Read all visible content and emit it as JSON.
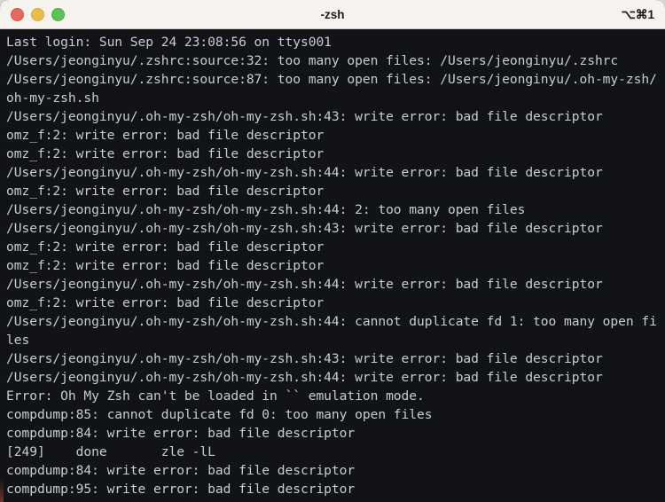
{
  "window": {
    "title": "-zsh",
    "shortcut": "⌥⌘1",
    "controls": {
      "close_label": "close",
      "minimize_label": "minimize",
      "zoom_label": "zoom"
    },
    "colors": {
      "titlebar_bg": "#f6f2ee",
      "terminal_bg": "#121317",
      "terminal_fg": "#c8ccd4",
      "close": "#e4695e",
      "minimize": "#e8bd4c",
      "zoom": "#5cc257"
    }
  },
  "terminal": {
    "output": "Last login: Sun Sep 24 23:08:56 on ttys001\n/Users/jeonginyu/.zshrc:source:32: too many open files: /Users/jeonginyu/.zshrc\n/Users/jeonginyu/.zshrc:source:87: too many open files: /Users/jeonginyu/.oh-my-zsh/oh-my-zsh.sh\n/Users/jeonginyu/.oh-my-zsh/oh-my-zsh.sh:43: write error: bad file descriptor\nomz_f:2: write error: bad file descriptor\nomz_f:2: write error: bad file descriptor\n/Users/jeonginyu/.oh-my-zsh/oh-my-zsh.sh:44: write error: bad file descriptor\nomz_f:2: write error: bad file descriptor\n/Users/jeonginyu/.oh-my-zsh/oh-my-zsh.sh:44: 2: too many open files\n/Users/jeonginyu/.oh-my-zsh/oh-my-zsh.sh:43: write error: bad file descriptor\nomz_f:2: write error: bad file descriptor\nomz_f:2: write error: bad file descriptor\n/Users/jeonginyu/.oh-my-zsh/oh-my-zsh.sh:44: write error: bad file descriptor\nomz_f:2: write error: bad file descriptor\n/Users/jeonginyu/.oh-my-zsh/oh-my-zsh.sh:44: cannot duplicate fd 1: too many open files\n/Users/jeonginyu/.oh-my-zsh/oh-my-zsh.sh:43: write error: bad file descriptor\n/Users/jeonginyu/.oh-my-zsh/oh-my-zsh.sh:44: write error: bad file descriptor\nError: Oh My Zsh can't be loaded in `` emulation mode.\ncompdump:85: cannot duplicate fd 0: too many open files\ncompdump:84: write error: bad file descriptor\n[249]    done       zle -lL\ncompdump:84: write error: bad file descriptor\ncompdump:95: write error: bad file descriptor"
  }
}
